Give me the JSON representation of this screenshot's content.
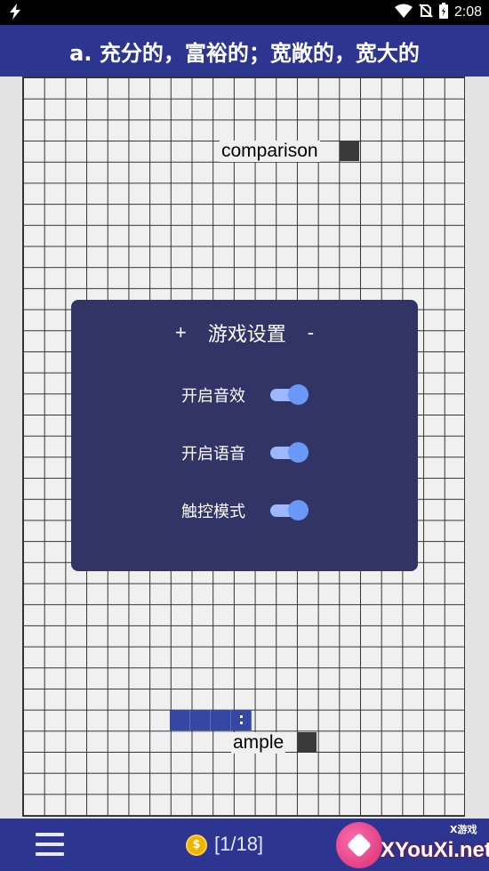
{
  "status_bar": {
    "time": "2:08"
  },
  "header": {
    "title": "a. 充分的，富裕的；宽敞的，宽大的"
  },
  "board": {
    "words": [
      {
        "text": "comparison"
      },
      {
        "text": "ample"
      }
    ]
  },
  "settings_dialog": {
    "plus_label": "+",
    "title": "游戏设置",
    "minus_label": "-",
    "options": [
      {
        "label": "开启音效",
        "enabled": true
      },
      {
        "label": "开启语音",
        "enabled": true
      },
      {
        "label": "触控模式",
        "enabled": true
      }
    ]
  },
  "bottom_bar": {
    "coin_symbol": "$",
    "progress": "[1/18]"
  },
  "watermark": {
    "site": "XYouXi.net",
    "brand": "X游戏"
  },
  "colors": {
    "header_bg": "#2c3590",
    "dialog_bg": "#333466",
    "toggle_on": "#6a99f5",
    "snake": "#3447a3"
  },
  "icons": [
    "lightning-icon",
    "wifi-icon",
    "no-sim-icon",
    "battery-icon",
    "hamburger-menu-icon",
    "coin-icon"
  ]
}
